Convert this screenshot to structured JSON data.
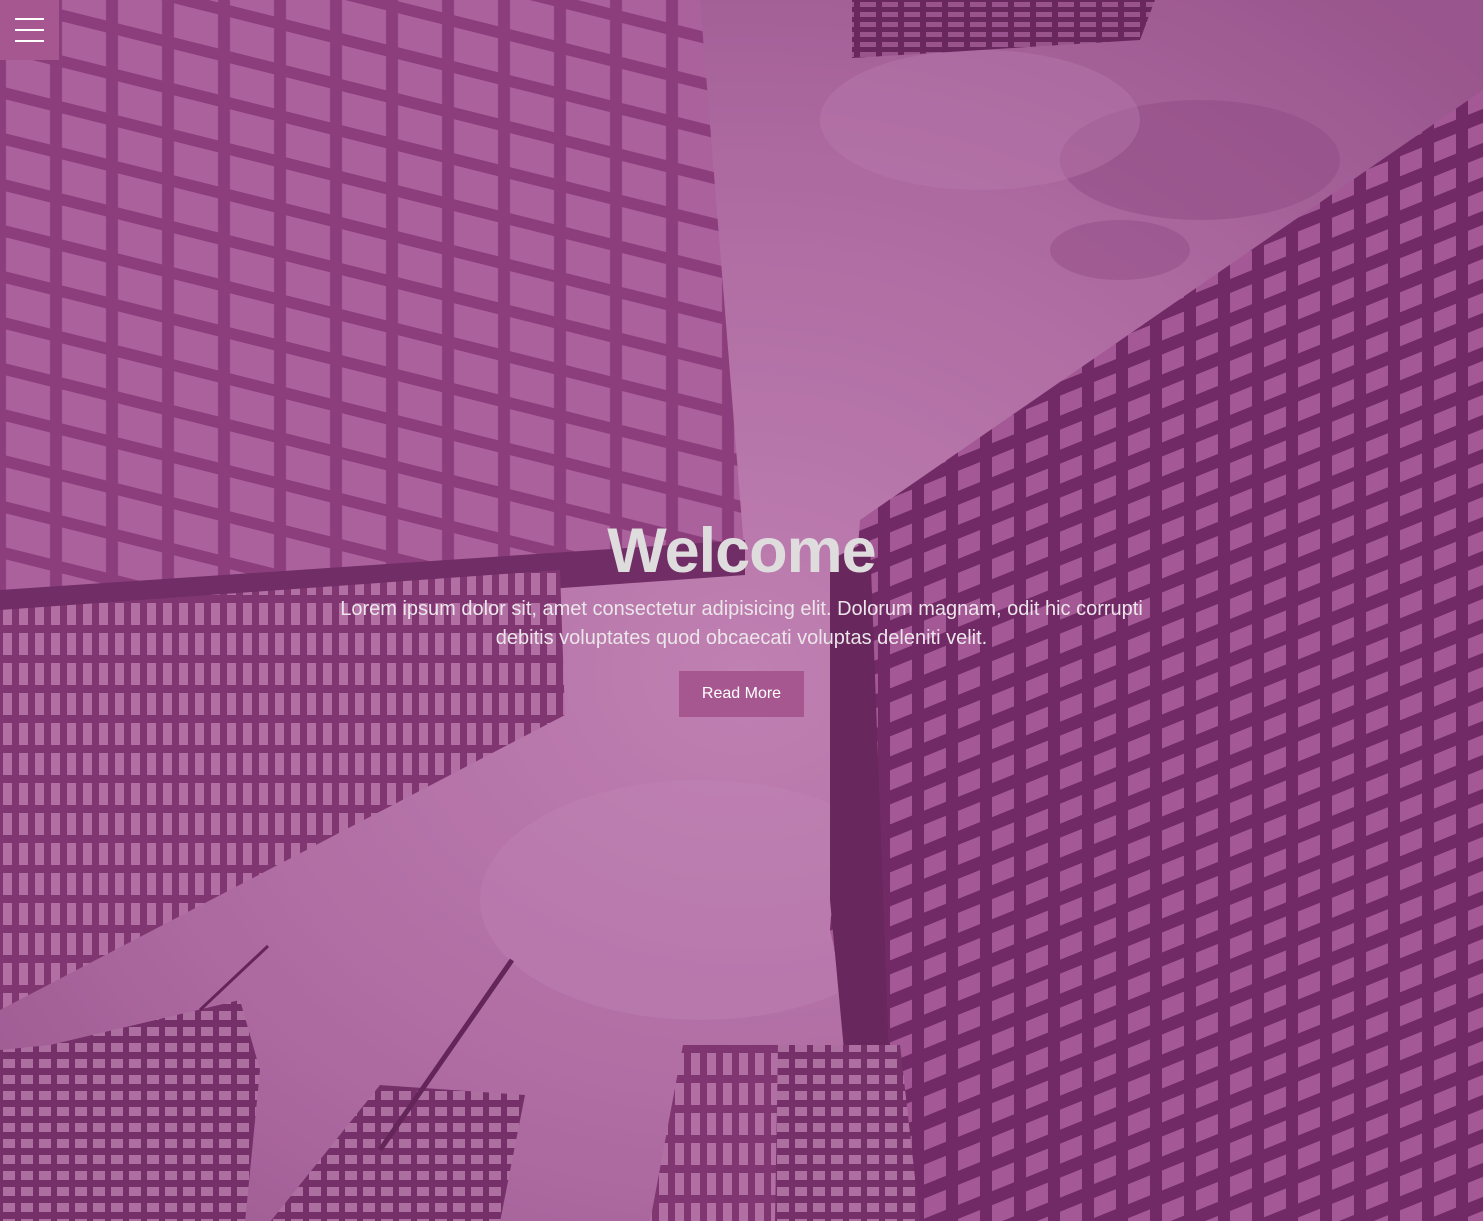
{
  "hero": {
    "title": "Welcome",
    "subtitle": "Lorem ipsum dolor sit, amet consectetur adipisicing elit. Dolorum magnam, odit hic corrupti debitis voluptates quod obcaecati voluptas deleniti velit.",
    "button_label": "Read More",
    "background_image": "skyscrapers-looking-up"
  },
  "menu": {
    "icon": "hamburger-menu-icon"
  },
  "colors": {
    "accent": "#a7578f",
    "overlay_tint": "#b56aa6",
    "title_text": "#dedcdd",
    "body_text": "#ece6ea"
  }
}
